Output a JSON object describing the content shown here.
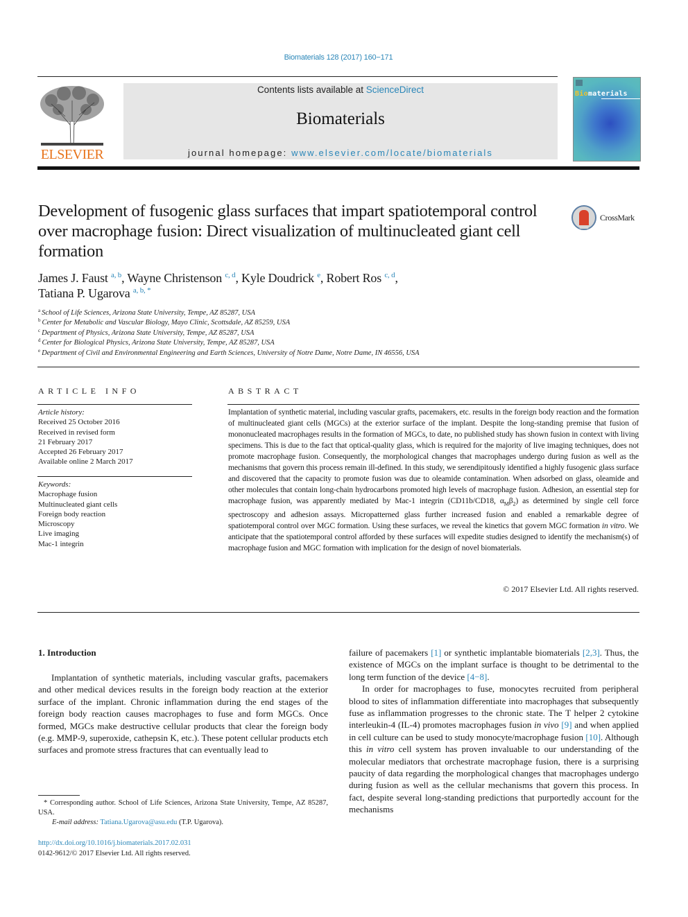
{
  "header": {
    "journal_reference": "Biomaterials 128 (2017) 160−171",
    "contents_prefix": "Contents lists available at ",
    "contents_link": "ScienceDirect",
    "journal_title": "Biomaterials",
    "homepage_prefix": "journal homepage: ",
    "homepage_link": "www.elsevier.com/locate/biomaterials",
    "publisher_logo_text": "ELSEVIER",
    "cover_title_accent": "Bio",
    "cover_title_rest": "materials",
    "crossmark_label": "CrossMark",
    "colors": {
      "link": "#2a86b8",
      "elsevier_orange": "#e8731a",
      "masthead_bg": "#e6e6e6"
    }
  },
  "article": {
    "title": "Development of fusogenic glass surfaces that impart spatiotemporal control over macrophage fusion: Direct visualization of multinucleated giant cell formation",
    "authors": [
      {
        "name": "James J. Faust",
        "affils": "a, b",
        "sep": ", "
      },
      {
        "name": "Wayne Christenson",
        "affils": "c, d",
        "sep": ", "
      },
      {
        "name": "Kyle Doudrick",
        "affils": "e",
        "sep": ", "
      },
      {
        "name": "Robert Ros",
        "affils": "c, d",
        "sep": ","
      },
      {
        "name": "Tatiana P. Ugarova",
        "affils": "a, b, *",
        "sep": ""
      }
    ],
    "affiliations": [
      {
        "key": "a",
        "text": "School of Life Sciences, Arizona State University, Tempe, AZ 85287, USA"
      },
      {
        "key": "b",
        "text": "Center for Metabolic and Vascular Biology, Mayo Clinic, Scottsdale, AZ 85259, USA"
      },
      {
        "key": "c",
        "text": "Department of Physics, Arizona State University, Tempe, AZ 85287, USA"
      },
      {
        "key": "d",
        "text": "Center for Biological Physics, Arizona State University, Tempe, AZ 85287, USA"
      },
      {
        "key": "e",
        "text": "Department of Civil and Environmental Engineering and Earth Sciences, University of Notre Dame, Notre Dame, IN 46556, USA"
      }
    ]
  },
  "article_info": {
    "heading": "ARTICLE INFO",
    "history_label": "Article history:",
    "history": [
      "Received 25 October 2016",
      "Received in revised form",
      "21 February 2017",
      "Accepted 26 February 2017",
      "Available online 2 March 2017"
    ],
    "keywords_label": "Keywords:",
    "keywords": [
      "Macrophage fusion",
      "Multinucleated giant cells",
      "Foreign body reaction",
      "Microscopy",
      "Live imaging",
      "Mac-1 integrin"
    ]
  },
  "abstract": {
    "heading": "ABSTRACT",
    "part1": "Implantation of synthetic material, including vascular grafts, pacemakers, etc. results in the foreign body reaction and the formation of multinucleated giant cells (MGCs) at the exterior surface of the implant. Despite the long-standing premise that fusion of mononucleated macrophages results in the formation of MGCs, to date, no published study has shown fusion in context with living specimens. This is due to the fact that optical-quality glass, which is required for the majority of live imaging techniques, does not promote macrophage fusion. Consequently, the morphological changes that macrophages undergo during fusion as well as the mechanisms that govern this process remain ill-defined. In this study, we serendipitously identified a highly fusogenic glass surface and discovered that the capacity to promote fusion was due to oleamide contamination. When adsorbed on glass, oleamide and other molecules that contain long-chain hydrocarbons promoted high levels of macrophage fusion. Adhesion, an essential step for macrophage fusion, was apparently mediated by Mac-1 integrin (CD11b/CD18, ",
    "alpha": "α",
    "alpha_sub": "M",
    "beta": "β",
    "beta_sub": "2",
    "part2": ") as determined by single cell force spectroscopy and adhesion assays. Micropatterned glass further increased fusion and enabled a remarkable degree of spatiotemporal control over MGC formation. Using these surfaces, we reveal the kinetics that govern MGC formation ",
    "italic": "in vitro",
    "part3": ". We anticipate that the spatiotemporal control afforded by these surfaces will expedite studies designed to identify the mechanism(s) of macrophage fusion and MGC formation with implication for the design of novel biomaterials.",
    "copyright": "© 2017 Elsevier Ltd. All rights reserved."
  },
  "body": {
    "section_heading": "1.  Introduction",
    "left_paragraph": "Implantation of synthetic materials, including vascular grafts, pacemakers and other medical devices results in the foreign body reaction at the exterior surface of the implant. Chronic inflammation during the end stages of the foreign body reaction causes macrophages to fuse and form MGCs. Once formed, MGCs make destructive cellular products that clear the foreign body (e.g. MMP-9, superoxide, cathepsin K, etc.). These potent cellular products etch surfaces and promote stress fractures that can eventually lead to",
    "right_p1": {
      "t1": "failure of pacemakers ",
      "ref1": "[1]",
      "t2": " or synthetic implantable biomaterials ",
      "ref2": "[2,3]",
      "t3": ". Thus, the existence of MGCs on the implant surface is thought to be detrimental to the long term function of the device ",
      "ref3": "[4−8]",
      "t4": "."
    },
    "right_p2": {
      "t1": "In order for macrophages to fuse, monocytes recruited from peripheral blood to sites of inflammation differentiate into macrophages that subsequently fuse as inflammation progresses to the chronic state. The T helper 2 cytokine interleukin-4 (IL-4) promotes macrophages fusion ",
      "i1": "in vivo",
      "t2": " ",
      "ref1": "[9]",
      "t3": " and when applied in cell culture can be used to study monocyte/macrophage fusion ",
      "ref2": "[10]",
      "t4": ". Although this ",
      "i2": "in vitro",
      "t5": " cell system has proven invaluable to our understanding of the molecular mediators that orchestrate macrophage fusion, there is a surprising paucity of data regarding the morphological changes that macrophages undergo during fusion as well as the cellular mechanisms that govern this process. In fact, despite several long-standing predictions that purportedly account for the mechanisms"
    }
  },
  "footer": {
    "corresponding_note": "* Corresponding author. School of Life Sciences, Arizona State University, Tempe, AZ 85287, USA.",
    "email_label": "E-mail address:",
    "email": "Tatiana.Ugarova@asu.edu",
    "email_suffix": " (T.P. Ugarova).",
    "doi": "http://dx.doi.org/10.1016/j.biomaterials.2017.02.031",
    "issn": "0142-9612/© 2017 Elsevier Ltd. All rights reserved."
  }
}
